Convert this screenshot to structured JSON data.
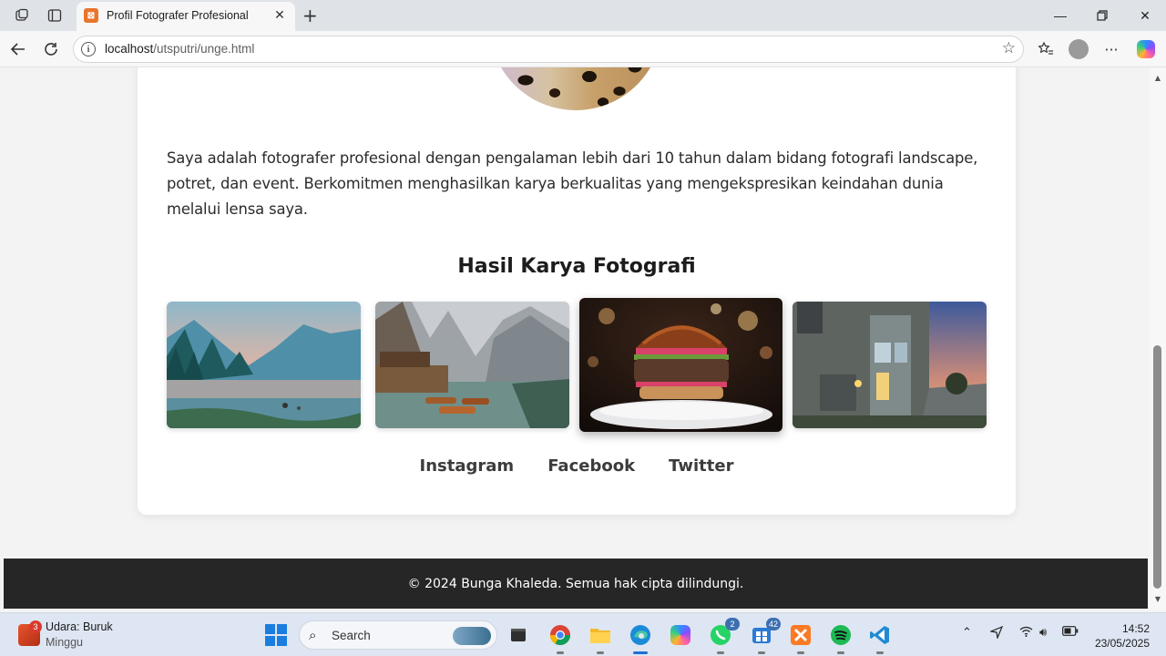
{
  "browser": {
    "tab_title": "Profil Fotografer Profesional",
    "tab_favicon_text": "⊠",
    "url_host": "localhost",
    "url_path": "/utsputri/unge.html"
  },
  "page": {
    "bio": "Saya adalah fotografer profesional dengan pengalaman lebih dari 10 tahun dalam bidang fotografi landscape, potret, dan event. Berkomitmen menghasilkan karya berkualitas yang mengekspresikan keindahan dunia melalui lensa saya.",
    "gallery_title": "Hasil Karya Fotografi",
    "gallery": [
      {
        "subject": "lake-mountains"
      },
      {
        "subject": "boats-dock-mountains"
      },
      {
        "subject": "burger"
      },
      {
        "subject": "modern-house-dusk"
      }
    ],
    "socials": [
      "Instagram",
      "Facebook",
      "Twitter"
    ],
    "footer": "© 2024 Bunga Khaleda. Semua hak cipta dilindungi."
  },
  "taskbar": {
    "weather_title": "Udara: Buruk",
    "weather_sub": "Minggu",
    "weather_badge": "3",
    "search_label": "Search",
    "whatsapp_badge": "2",
    "store_badge": "42",
    "time": "14:52",
    "date": "23/05/2025"
  },
  "colors": {
    "footer_bg": "#262626",
    "card_bg": "#ffffff",
    "page_bg": "#f3f3f3",
    "accent": "#1a7de0"
  }
}
